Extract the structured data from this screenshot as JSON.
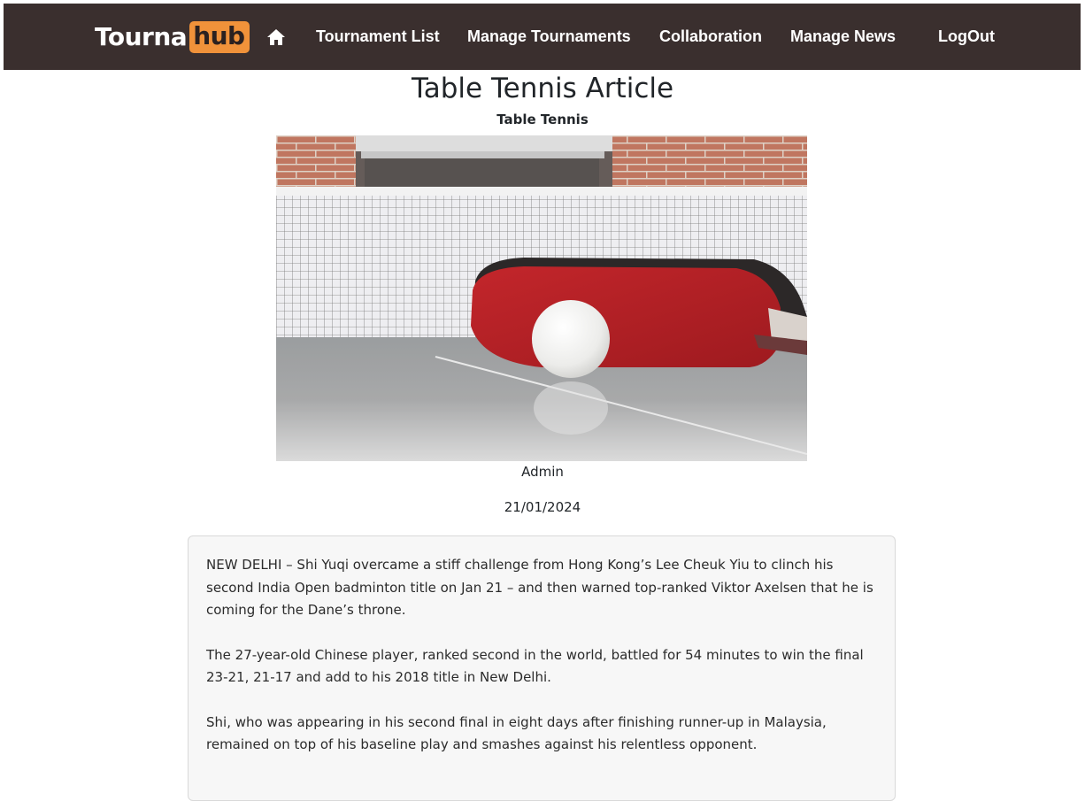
{
  "brand": {
    "part1": "Tourna",
    "part2": "hub"
  },
  "nav": {
    "home_icon": "home-icon",
    "tournament_list": "Tournament List",
    "manage_tournaments": "Manage Tournaments",
    "collaboration": "Collaboration",
    "manage_news": "Manage News",
    "logout": "LogOut"
  },
  "article": {
    "title": "Table Tennis Article",
    "category": "Table Tennis",
    "author": "Admin",
    "date": "21/01/2024",
    "paragraphs": [
      "NEW DELHI – Shi Yuqi overcame a stiff challenge from Hong Kong’s Lee Cheuk Yiu to clinch his second India Open badminton title on Jan 21 – and then warned top-ranked Viktor Axelsen that he is coming for the Dane’s throne.",
      "The 27-year-old Chinese player, ranked second in the world, battled for 54 minutes to win the final 23-21, 21-17 and add to his 2018 title in New Delhi.",
      "Shi, who was appearing in his second final in eight days after finishing runner-up in Malaysia, remained on top of his baseline play and smashes against his relentless opponent."
    ]
  },
  "colors": {
    "navbar_bg": "#3a2f2e",
    "brand_accent": "#f0923a",
    "article_bg": "#f7f7f7"
  }
}
